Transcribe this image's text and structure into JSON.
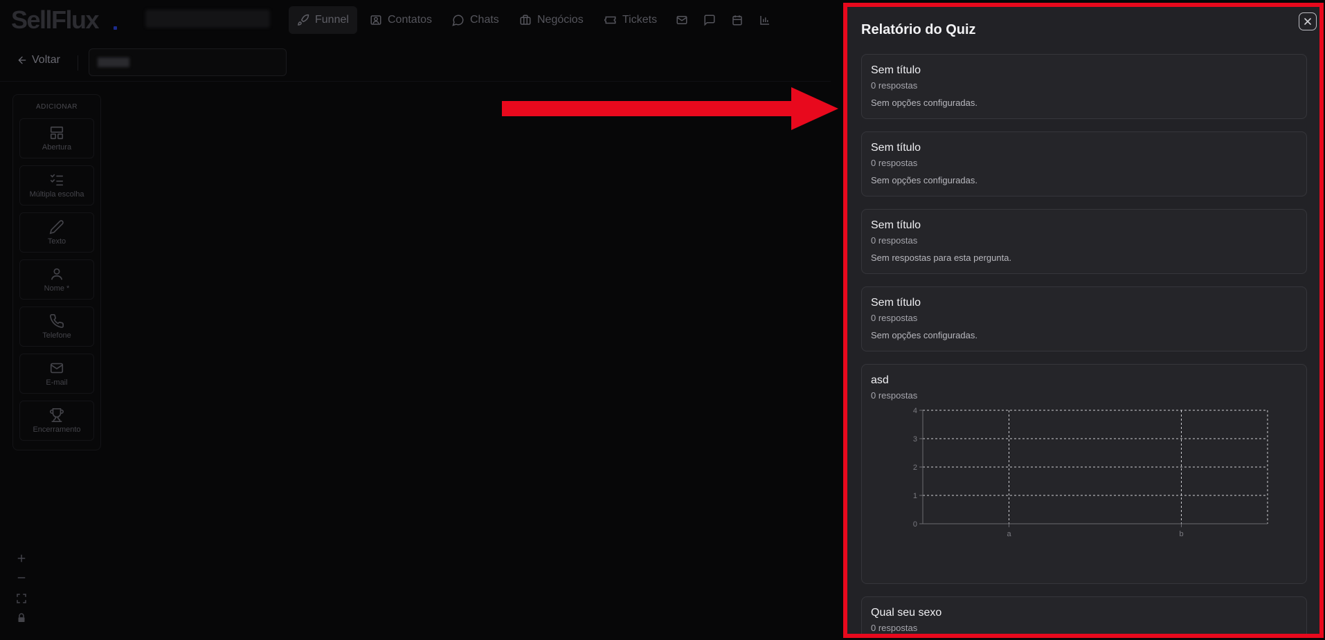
{
  "app": {
    "logo": "SellFlux"
  },
  "nav": {
    "items": [
      {
        "label": "Funnel",
        "icon": "rocket-icon",
        "active": true
      },
      {
        "label": "Contatos",
        "icon": "contact-card-icon",
        "active": false
      },
      {
        "label": "Chats",
        "icon": "chat-bubble-icon",
        "active": false
      },
      {
        "label": "Negócios",
        "icon": "briefcase-icon",
        "active": false
      },
      {
        "label": "Tickets",
        "icon": "ticket-icon",
        "active": false
      }
    ],
    "icon_buttons": [
      "mail-icon",
      "message-square-icon",
      "calendar-icon",
      "bar-chart-icon"
    ]
  },
  "subbar": {
    "back_label": "Voltar"
  },
  "palette": {
    "title": "ADICIONAR",
    "items": [
      {
        "label": "Abertura",
        "icon": "layout-icon"
      },
      {
        "label": "Múltipla escolha",
        "icon": "checklist-icon"
      },
      {
        "label": "Texto",
        "icon": "pencil-icon"
      },
      {
        "label": "Nome *",
        "icon": "user-icon"
      },
      {
        "label": "Telefone",
        "icon": "phone-icon"
      },
      {
        "label": "E-mail",
        "icon": "mail-icon"
      },
      {
        "label": "Encerramento",
        "icon": "trophy-icon"
      }
    ]
  },
  "report": {
    "title": "Relatório do Quiz",
    "questions": [
      {
        "title": "Sem título",
        "responses": "0 respostas",
        "message": "Sem opções configuradas."
      },
      {
        "title": "Sem título",
        "responses": "0 respostas",
        "message": "Sem opções configuradas."
      },
      {
        "title": "Sem título",
        "responses": "0 respostas",
        "message": "Sem respostas para esta pergunta."
      },
      {
        "title": "Sem título",
        "responses": "0 respostas",
        "message": "Sem opções configuradas."
      },
      {
        "title": "asd",
        "responses": "0 respostas",
        "message": ""
      },
      {
        "title": "Qual seu sexo",
        "responses": "0 respostas",
        "message": ""
      }
    ]
  },
  "chart_data": {
    "type": "bar",
    "categories": [
      "a",
      "b"
    ],
    "values": [
      0,
      0
    ],
    "title": "",
    "xlabel": "",
    "ylabel": "",
    "ylim": [
      0,
      4
    ],
    "yticks": [
      0,
      1,
      2,
      3,
      4
    ],
    "grid": true
  },
  "colors": {
    "highlight": "#e8091d",
    "panel_bg": "#222226",
    "card_bg": "#252529"
  }
}
